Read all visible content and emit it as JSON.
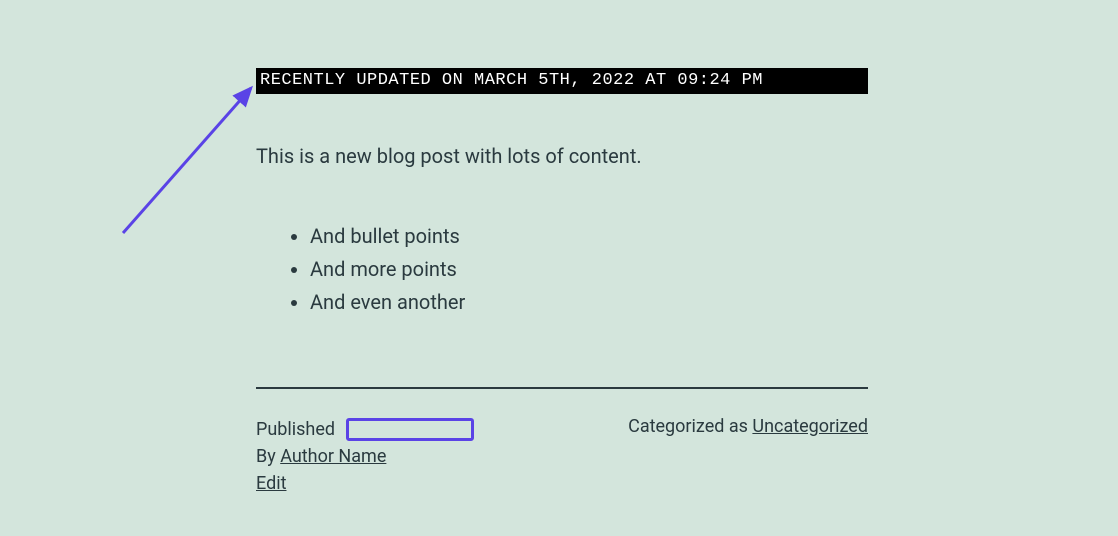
{
  "banner": {
    "text": "RECENTLY UPDATED ON MARCH 5TH, 2022 AT 09:24 PM"
  },
  "intro": "This is a new blog post with lots of content.",
  "bullets": [
    "And bullet points",
    "And more points",
    "And even another"
  ],
  "meta": {
    "published_label": "Published",
    "by_label": "By",
    "author_name": "Author Name",
    "edit_label": "Edit",
    "categorized_label": "Categorized as",
    "category": "Uncategorized"
  }
}
